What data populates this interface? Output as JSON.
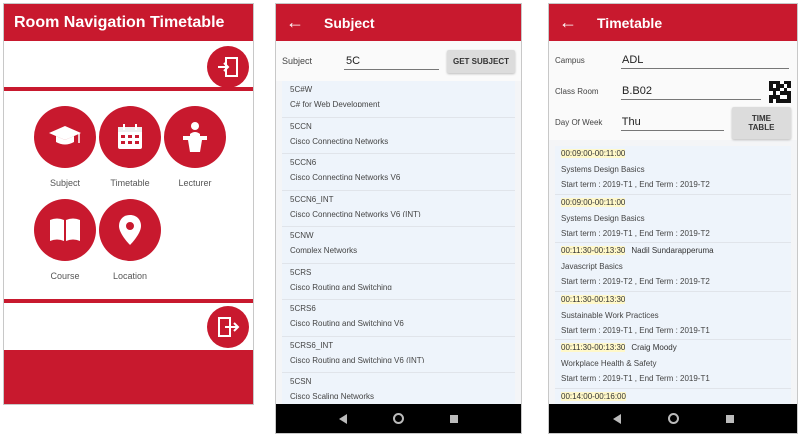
{
  "screen1": {
    "title": "Room Navigation Timetable",
    "tiles": [
      {
        "label": "Subject",
        "icon": "graduation-cap-icon"
      },
      {
        "label": "Timetable",
        "icon": "calendar-icon"
      },
      {
        "label": "Lecturer",
        "icon": "lecturer-podium-icon"
      },
      {
        "label": "Course",
        "icon": "open-book-icon"
      },
      {
        "label": "Location",
        "icon": "map-pin-icon"
      }
    ],
    "accent": "#c8192e"
  },
  "screen2": {
    "title": "Subject",
    "subject_label": "Subject",
    "subject_value": "5C",
    "get_button": "GET SUBJECT",
    "items": [
      {
        "code": "5C#W",
        "name": "C# for Web Development"
      },
      {
        "code": "5CCN",
        "name": "Cisco Connecting Networks"
      },
      {
        "code": "5CCN6",
        "name": "Cisco Connecting Networks V6"
      },
      {
        "code": "5CCN6_INT",
        "name": "Cisco Connecting Networks V6 (INT)"
      },
      {
        "code": "5CNW",
        "name": "Complex Networks"
      },
      {
        "code": "5CRS",
        "name": "Cisco Routing and Switching"
      },
      {
        "code": "5CRS6",
        "name": "Cisco Routing and Switching V6"
      },
      {
        "code": "5CRS6_INT",
        "name": "Cisco Routing and Switching V6 (INT)"
      },
      {
        "code": "5CSN",
        "name": "Cisco Scaling Networks"
      }
    ]
  },
  "screen3": {
    "title": "Timetable",
    "campus_label": "Campus",
    "campus_value": "ADL",
    "room_label": "Class Room",
    "room_value": "B.B02",
    "day_label": "Day Of Week",
    "day_value": "Thu",
    "tt_button": "TIME TABLE",
    "entries": [
      {
        "time": "00:09:00-00:11:00",
        "subject": "Systems Design Basics",
        "terms": "Start term :  2019-T1  , End Term :  2019-T2"
      },
      {
        "time": "00:09:00-00:11:00",
        "subject": "Systems Design Basics",
        "terms": "Start term :  2019-T1  , End Term :  2019-T2"
      },
      {
        "time": "00:11:30-00:13:30",
        "extra": "Nadil Sundarapperuma",
        "subject": "Javascript Basics",
        "terms": "Start term :  2019-T2  , End Term :  2019-T2"
      },
      {
        "time": "00:11:30-00:13:30",
        "subject": "Sustainable Work Practices",
        "terms": "Start term :  2019-T1  , End Term :  2019-T1"
      },
      {
        "time": "00:11:30-00:13:30",
        "extra": "Craig Moody",
        "subject": "Workplace Health & Safety",
        "terms": "Start term :  2019-T1  , End Term :  2019-T1"
      },
      {
        "time": "00:14:00-00:16:00",
        "subject": "",
        "terms": ""
      }
    ]
  }
}
